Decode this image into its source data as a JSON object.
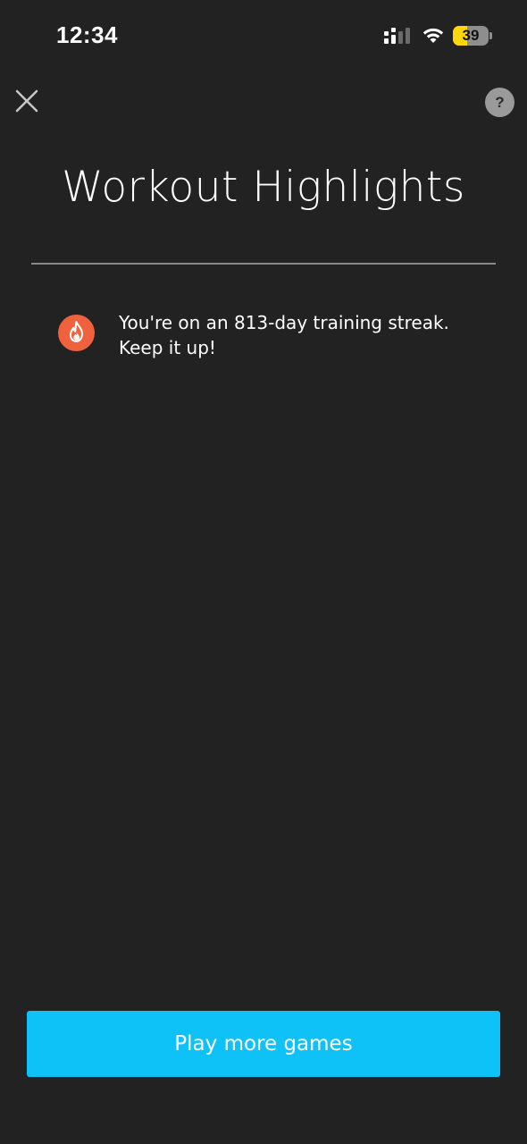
{
  "status_bar": {
    "time": "12:34",
    "battery_level": 39,
    "battery_label": "39",
    "icons": [
      "signal-icon",
      "wifi-icon",
      "battery-icon"
    ],
    "battery_color": "#ffd60a"
  },
  "header": {
    "close_icon": "close-icon",
    "help_label": "?",
    "title": "Workout Highlights"
  },
  "highlights": [
    {
      "icon": "flame-icon",
      "icon_color": "#f0613d",
      "line1": "You're on an 813-day training streak.",
      "line2": "Keep it up!"
    }
  ],
  "footer": {
    "play_button_label": "Play more games",
    "button_color": "#0ec2f8"
  },
  "colors": {
    "background": "#222222",
    "text": "#ffffff",
    "divider": "#8a8a8a"
  }
}
